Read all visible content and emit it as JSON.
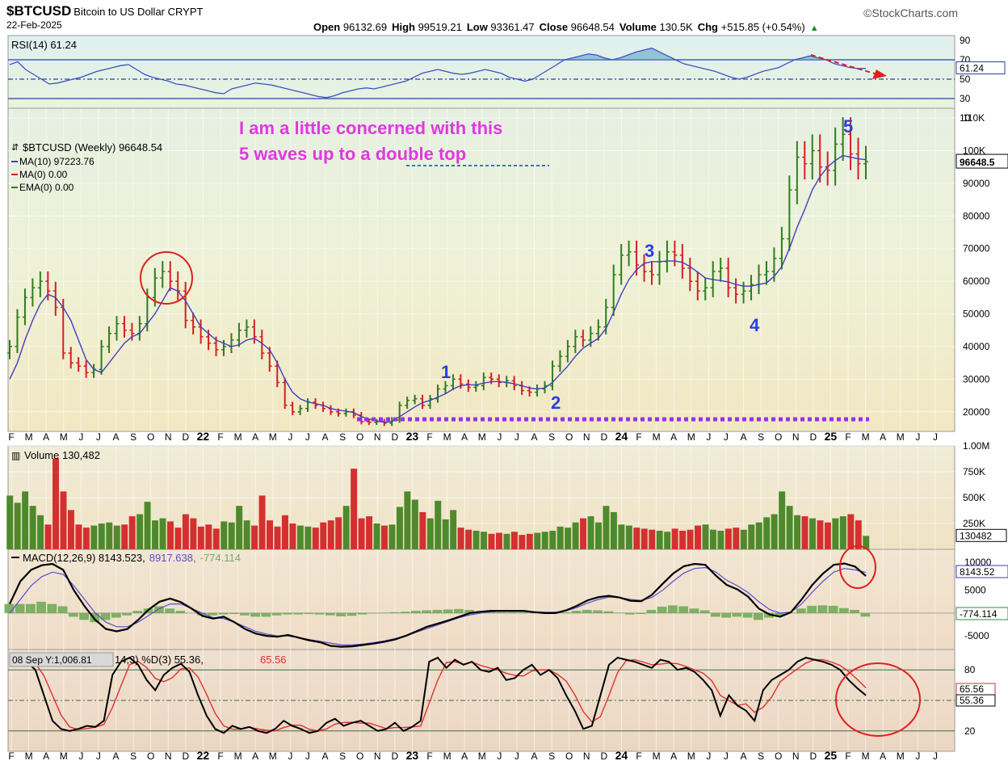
{
  "header": {
    "symbol": "$BTCUSD",
    "description": "Bitcoin to US Dollar",
    "exchange": "CRYPT",
    "date": "22-Feb-2025",
    "brand": "©StockCharts.com",
    "ohlc": [
      {
        "label": "Open",
        "value": "96132.69"
      },
      {
        "label": "High",
        "value": "99519.21"
      },
      {
        "label": "Low",
        "value": "93361.47"
      },
      {
        "label": "Close",
        "value": "96648.54"
      },
      {
        "label": "Volume",
        "value": "130.5K"
      },
      {
        "label": "Chg",
        "value": "+515.85 (+0.54%)"
      }
    ],
    "chg_arrow": "▲"
  },
  "colors": {
    "up": "#2e7d1f",
    "down": "#d42020",
    "ma": "#3f3fbf",
    "annotation": "#e038e0",
    "wave_label": "#2a3ee0",
    "circle": "#e02020",
    "support": "#9b30e8",
    "rsi_fill": "#5fa5c8",
    "macd_line": "#000000",
    "macd_signal": "#5a4bd0",
    "hist": "#6aa84f",
    "stoch_k": "#000000",
    "stoch_d": "#e03030"
  },
  "chart_data": [
    {
      "panel": "rsi",
      "type": "line",
      "label": "RSI(14) 61.24",
      "last_value": 61.24,
      "last_label": "61.24",
      "ylim": [
        20,
        95
      ],
      "levels": [
        70,
        50,
        30
      ],
      "tick_labels": [
        "90",
        "70",
        "50",
        "30",
        "10"
      ],
      "tick_values": [
        90,
        70,
        50,
        30,
        10
      ],
      "values": [
        65,
        68,
        60,
        55,
        50,
        45,
        46,
        48,
        50,
        52,
        55,
        58,
        60,
        62,
        64,
        65,
        60,
        55,
        52,
        50,
        48,
        45,
        44,
        42,
        40,
        38,
        36,
        35,
        40,
        42,
        44,
        46,
        45,
        44,
        42,
        40,
        38,
        36,
        34,
        32,
        31,
        33,
        36,
        38,
        40,
        41,
        40,
        42,
        44,
        46,
        48,
        52,
        56,
        58,
        60,
        58,
        56,
        55,
        56,
        58,
        60,
        58,
        56,
        52,
        50,
        48,
        50,
        55,
        60,
        65,
        70,
        72,
        74,
        76,
        75,
        72,
        70,
        72,
        75,
        78,
        80,
        82,
        78,
        74,
        70,
        66,
        64,
        62,
        60,
        58,
        55,
        52,
        50,
        52,
        55,
        58,
        60,
        62,
        66,
        70,
        72,
        74,
        72,
        70,
        66,
        64,
        62,
        61,
        61
      ]
    },
    {
      "panel": "price",
      "type": "ohlc-bar",
      "title": "$BTCUSD (Weekly) 96648.54",
      "legend": [
        {
          "label": "MA(10) 97223.76",
          "color": "#3f3fbf"
        },
        {
          "label": "MA(0) 0.00",
          "color": "#d42020"
        },
        {
          "label": "EMA(0) 0.00",
          "color": "#2e7d1f"
        }
      ],
      "ylim": [
        14000,
        113000
      ],
      "y_ticks": [
        20000,
        30000,
        40000,
        50000,
        60000,
        70000,
        80000,
        90000,
        100000,
        110000
      ],
      "y_tick_labels": [
        "20000",
        "30000",
        "40000",
        "50000",
        "60000",
        "70000",
        "80000",
        "90000",
        "100K",
        "110K"
      ],
      "last_label": "96648.5",
      "last_value": 96648.54,
      "closes": [
        40000,
        49000,
        55000,
        58000,
        60000,
        57000,
        52000,
        38000,
        35000,
        34000,
        32000,
        33000,
        40000,
        44000,
        47000,
        45000,
        44000,
        47000,
        55000,
        61000,
        63000,
        60000,
        57000,
        48000,
        46000,
        43000,
        41000,
        39000,
        40000,
        42000,
        45000,
        46000,
        43000,
        38000,
        34000,
        29000,
        22000,
        20000,
        21000,
        23000,
        22000,
        21000,
        20000,
        19500,
        20000,
        19000,
        17000,
        16800,
        17000,
        16500,
        17500,
        22000,
        23500,
        24000,
        22000,
        24000,
        27000,
        28000,
        30000,
        28500,
        27500,
        28000,
        30500,
        30000,
        29000,
        29500,
        28000,
        26500,
        26000,
        27000,
        28000,
        34000,
        37000,
        40000,
        43000,
        42000,
        44000,
        46000,
        52000,
        62000,
        68000,
        69000,
        65000,
        63000,
        62000,
        66000,
        69000,
        68000,
        64000,
        60000,
        57000,
        58000,
        63000,
        64000,
        58000,
        56000,
        57000,
        59000,
        62000,
        63000,
        67000,
        73000,
        88000,
        98000,
        96000,
        100000,
        95000,
        94000,
        102000,
        105000,
        99000,
        96000,
        96648
      ],
      "ma10": [
        30000,
        35000,
        42000,
        48000,
        53000,
        56000,
        55000,
        52000,
        48000,
        42000,
        36000,
        33000,
        32000,
        35000,
        38000,
        41000,
        43000,
        44000,
        47000,
        50000,
        54000,
        58000,
        57000,
        54000,
        50000,
        46000,
        44000,
        42000,
        41000,
        40000,
        40500,
        42000,
        42500,
        41000,
        39000,
        35000,
        30000,
        26000,
        24000,
        23000,
        22500,
        22000,
        21000,
        20500,
        20200,
        19800,
        18500,
        17800,
        17200,
        16800,
        17000,
        18500,
        20000,
        21500,
        22800,
        23500,
        24500,
        25500,
        27000,
        28000,
        28300,
        28200,
        28800,
        29200,
        29300,
        29000,
        28600,
        28000,
        27300,
        27000,
        27300,
        29000,
        31500,
        34000,
        37000,
        39500,
        41000,
        42500,
        45500,
        50500,
        56000,
        60500,
        63500,
        65500,
        66000,
        66000,
        66200,
        66200,
        65800,
        64500,
        62800,
        61000,
        60500,
        60200,
        59800,
        59000,
        58500,
        58500,
        59000,
        59500,
        61500,
        64500,
        70000,
        76500,
        82000,
        88000,
        92000,
        95000,
        97000,
        98500,
        98000,
        97500,
        97224
      ]
    },
    {
      "panel": "volume",
      "type": "bar",
      "label": "Volume 130,482",
      "last_value": 130482,
      "last_label": "130482",
      "ylim": [
        0,
        1000000
      ],
      "y_ticks": [
        1000000,
        750000,
        500000,
        250000
      ],
      "y_tick_labels": [
        "1.00M",
        "750K",
        "500K",
        "250K"
      ],
      "values": [
        520000,
        450000,
        560000,
        420000,
        330000,
        240000,
        880000,
        560000,
        380000,
        240000,
        210000,
        230000,
        250000,
        260000,
        230000,
        240000,
        320000,
        340000,
        460000,
        280000,
        300000,
        270000,
        210000,
        340000,
        300000,
        220000,
        240000,
        200000,
        270000,
        260000,
        420000,
        280000,
        230000,
        520000,
        280000,
        220000,
        330000,
        250000,
        230000,
        220000,
        210000,
        260000,
        280000,
        310000,
        420000,
        780000,
        300000,
        320000,
        250000,
        230000,
        240000,
        410000,
        560000,
        480000,
        360000,
        300000,
        470000,
        290000,
        380000,
        210000,
        190000,
        180000,
        170000,
        150000,
        160000,
        150000,
        170000,
        140000,
        150000,
        160000,
        170000,
        180000,
        220000,
        210000,
        260000,
        300000,
        320000,
        260000,
        420000,
        360000,
        240000,
        230000,
        210000,
        200000,
        190000,
        180000,
        170000,
        200000,
        180000,
        190000,
        230000,
        240000,
        190000,
        180000,
        200000,
        210000,
        190000,
        240000,
        260000,
        310000,
        340000,
        560000,
        420000,
        330000,
        320000,
        300000,
        280000,
        260000,
        300000,
        320000,
        340000,
        280000,
        130482
      ]
    },
    {
      "panel": "macd",
      "type": "line",
      "label": "MACD(12,26,9) 8143.523, 8917.638, -774.114",
      "label_parts": [
        "MACD(12,26,9) 8143.523,",
        "8917.638,",
        "-774.114"
      ],
      "last_macd_label": "8143.52",
      "last_hist_label": "-774.114",
      "ylim": [
        -8000,
        14000
      ],
      "y_ticks": [
        5000,
        -5000
      ],
      "y_tick_labels": [
        "5000",
        "-5000"
      ],
      "top_tick_label": "10000",
      "macd": [
        2000,
        7000,
        9500,
        10500,
        10800,
        9500,
        5000,
        1500,
        -1500,
        -3500,
        -4000,
        -3500,
        -1500,
        800,
        2500,
        3200,
        2400,
        1000,
        -600,
        -1200,
        -800,
        -2000,
        -3500,
        -4500,
        -5000,
        -5200,
        -4800,
        -5400,
        -6000,
        -6400,
        -7200,
        -7400,
        -7300,
        -7000,
        -6700,
        -6300,
        -5800,
        -5000,
        -4000,
        -3000,
        -2300,
        -1600,
        -800,
        0,
        300,
        500,
        500,
        500,
        500,
        200,
        0,
        0,
        600,
        1600,
        2800,
        3500,
        3800,
        3400,
        2700,
        2600,
        4000,
        6400,
        8700,
        10300,
        10800,
        10600,
        8200,
        6200,
        5200,
        3600,
        1000,
        -300,
        -800,
        200,
        3000,
        6200,
        8700,
        10600,
        10900,
        10200,
        8143
      ],
      "signal": [
        0,
        3000,
        6000,
        8000,
        9000,
        8500,
        6000,
        3000,
        0,
        -2000,
        -3000,
        -3000,
        -2000,
        -500,
        1000,
        2000,
        2000,
        1000,
        0,
        -1000,
        -1200,
        -2000,
        -3000,
        -4000,
        -4600,
        -5000,
        -5000,
        -5400,
        -5800,
        -6200,
        -6600,
        -7000,
        -7000,
        -6800,
        -6500,
        -6100,
        -5600,
        -5000,
        -4200,
        -3400,
        -2600,
        -1800,
        -1000,
        -400,
        0,
        300,
        400,
        400,
        400,
        300,
        200,
        200,
        500,
        1200,
        2200,
        3000,
        3500,
        3400,
        3000,
        2800,
        3400,
        5000,
        7000,
        8800,
        9800,
        10000,
        9000,
        7200,
        6000,
        4500,
        2500,
        800,
        0,
        200,
        2000,
        4600,
        7000,
        9000,
        9800,
        9500,
        8918
      ],
      "hist": [
        2000,
        2000,
        2000,
        2500,
        2000,
        1500,
        -800,
        -1500,
        -2000,
        -1500,
        -1000,
        -500,
        500,
        1000,
        1500,
        1000,
        500,
        0,
        -500,
        -500,
        -300,
        -200,
        -500,
        -800,
        -800,
        -500,
        -300,
        -300,
        -200,
        -300,
        -500,
        -700,
        -600,
        -300,
        -100,
        100,
        200,
        300,
        500,
        600,
        700,
        800,
        900,
        700,
        400,
        300,
        200,
        200,
        200,
        0,
        0,
        0,
        200,
        500,
        700,
        600,
        400,
        100,
        -300,
        -200,
        700,
        1400,
        1700,
        1500,
        1000,
        600,
        -800,
        -1000,
        -800,
        -1000,
        -1500,
        -1000,
        -700,
        100,
        1000,
        1600,
        1700,
        1600,
        1100,
        700,
        -774
      ]
    },
    {
      "panel": "stochastic",
      "type": "line",
      "label_parts": [
        "08 Sep Y:1,006.81",
        "14,3) %D(3) 55.36,",
        "65.56"
      ],
      "last_k_label": "55.36",
      "last_d_label": "65.56",
      "ylim": [
        0,
        100
      ],
      "levels": [
        80,
        50,
        20
      ],
      "y_ticks": [
        80,
        20
      ],
      "y_tick_labels": [
        "80",
        "20"
      ],
      "k": [
        90,
        92,
        88,
        80,
        55,
        30,
        22,
        20,
        22,
        25,
        24,
        30,
        75,
        88,
        92,
        85,
        70,
        60,
        75,
        82,
        86,
        78,
        55,
        35,
        22,
        18,
        25,
        22,
        24,
        20,
        18,
        22,
        30,
        25,
        22,
        18,
        20,
        28,
        32,
        25,
        28,
        30,
        25,
        20,
        22,
        28,
        20,
        24,
        30,
        88,
        92,
        82,
        90,
        85,
        88,
        80,
        78,
        82,
        70,
        72,
        80,
        85,
        75,
        80,
        72,
        55,
        40,
        22,
        25,
        55,
        85,
        92,
        90,
        88,
        85,
        82,
        90,
        88,
        80,
        82,
        78,
        70,
        60,
        35,
        55,
        45,
        40,
        30,
        60,
        70,
        75,
        80,
        88,
        92,
        90,
        88,
        85,
        80,
        70,
        62,
        55
      ]
    }
  ],
  "x_axis": {
    "labels": [
      "F",
      "M",
      "A",
      "M",
      "J",
      "J",
      "A",
      "S",
      "O",
      "N",
      "D",
      "22",
      "F",
      "M",
      "A",
      "M",
      "J",
      "J",
      "A",
      "S",
      "O",
      "N",
      "D",
      "23",
      "F",
      "M",
      "A",
      "M",
      "J",
      "J",
      "A",
      "S",
      "O",
      "N",
      "D",
      "24",
      "F",
      "M",
      "A",
      "M",
      "J",
      "J",
      "A",
      "S",
      "O",
      "N",
      "D",
      "25",
      "F",
      "M",
      "A",
      "M",
      "J",
      "J"
    ],
    "bold": [
      "22",
      "23",
      "24",
      "25"
    ]
  },
  "annotations": {
    "comment_line1": "I am a little concerned with this",
    "comment_line2": "5 waves up to a double top",
    "waves": [
      "1",
      "2",
      "3",
      "4",
      "5"
    ]
  }
}
